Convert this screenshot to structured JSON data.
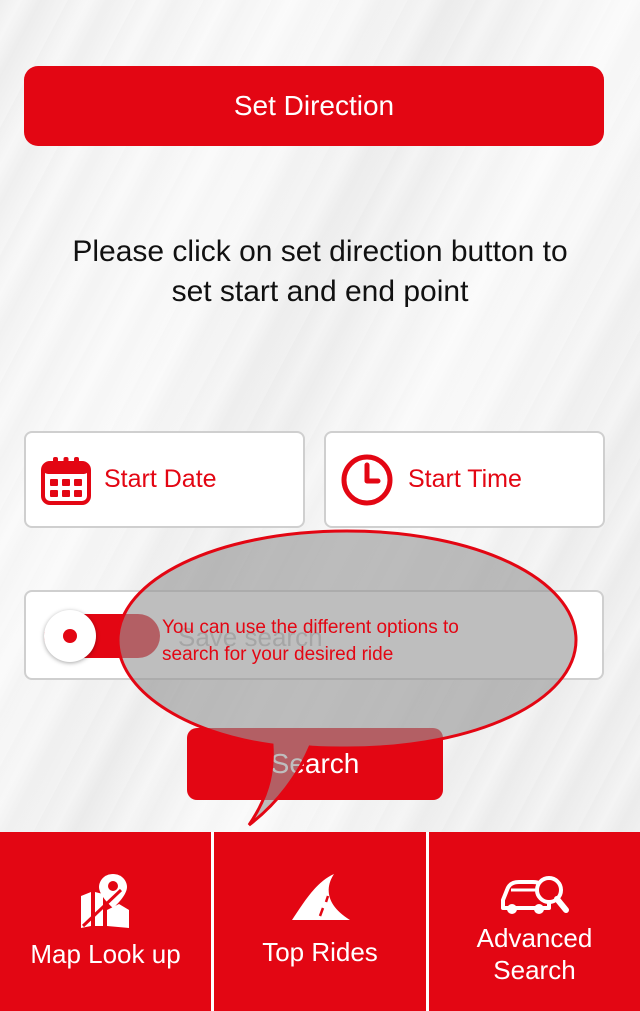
{
  "header": {
    "set_direction_label": "Set Direction"
  },
  "instruction": {
    "line1": "Please click on set direction button to",
    "line2": "set start and end point"
  },
  "form": {
    "start_date_label": "Start Date",
    "start_time_label": "Start Time",
    "save_search_label": "Save search",
    "save_search_on": true,
    "search_button_label": "Search"
  },
  "tooltip": {
    "text_line1": "You can use the different options to",
    "text_line2": "search for your desired ride"
  },
  "bottom_nav": {
    "items": [
      {
        "label": "Map Look up",
        "icon": "map-pin-icon"
      },
      {
        "label": "Top Rides",
        "icon": "road-icon"
      },
      {
        "label_line1": "Advanced",
        "label_line2": "Search",
        "icon": "car-search-icon"
      }
    ]
  },
  "colors": {
    "accent": "#e30613",
    "text": "#111111",
    "field_border": "#cfcfcf"
  }
}
